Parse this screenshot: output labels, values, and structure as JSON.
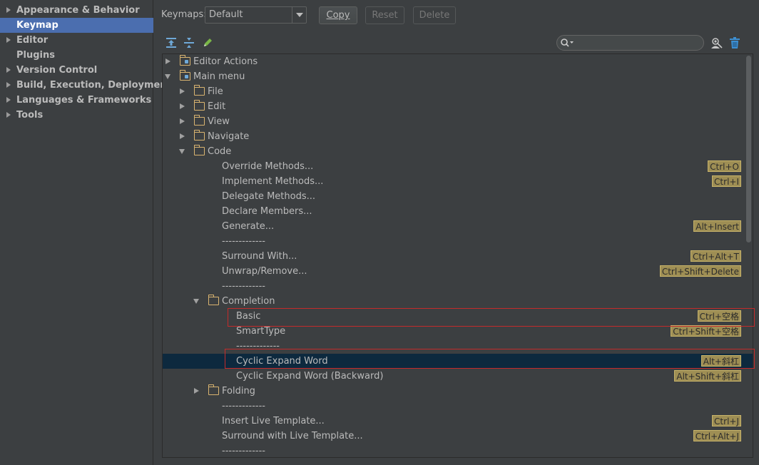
{
  "sidebar": {
    "items": [
      {
        "label": "Appearance & Behavior",
        "expandable": true,
        "selected": false
      },
      {
        "label": "Keymap",
        "expandable": false,
        "selected": true
      },
      {
        "label": "Editor",
        "expandable": true,
        "selected": false
      },
      {
        "label": "Plugins",
        "expandable": false,
        "selected": false
      },
      {
        "label": "Version Control",
        "expandable": true,
        "selected": false
      },
      {
        "label": "Build, Execution, Deployment",
        "expandable": true,
        "selected": false
      },
      {
        "label": "Languages & Frameworks",
        "expandable": true,
        "selected": false
      },
      {
        "label": "Tools",
        "expandable": true,
        "selected": false
      }
    ]
  },
  "header": {
    "keymaps_label": "Keymaps:",
    "keymap_value": "Default",
    "copy_label": "Copy",
    "reset_label": "Reset",
    "delete_label": "Delete"
  },
  "toolbar": {
    "icons": [
      "expand-all-icon",
      "collapse-all-icon",
      "edit-icon"
    ],
    "search_placeholder": "",
    "right_icons": [
      "find-shortcut-icon",
      "clear-icon"
    ]
  },
  "tree": {
    "rows": [
      {
        "label": "Editor Actions",
        "shortcut": ""
      },
      {
        "label": "Main menu",
        "shortcut": ""
      },
      {
        "label": "File",
        "shortcut": ""
      },
      {
        "label": "Edit",
        "shortcut": ""
      },
      {
        "label": "View",
        "shortcut": ""
      },
      {
        "label": "Navigate",
        "shortcut": ""
      },
      {
        "label": "Code",
        "shortcut": ""
      },
      {
        "label": "Override Methods...",
        "shortcut": "Ctrl+O"
      },
      {
        "label": "Implement Methods...",
        "shortcut": "Ctrl+I"
      },
      {
        "label": "Delegate Methods...",
        "shortcut": ""
      },
      {
        "label": "Declare Members...",
        "shortcut": ""
      },
      {
        "label": "Generate...",
        "shortcut": "Alt+Insert"
      },
      {
        "label": "-------------",
        "shortcut": ""
      },
      {
        "label": "Surround With...",
        "shortcut": "Ctrl+Alt+T"
      },
      {
        "label": "Unwrap/Remove...",
        "shortcut": "Ctrl+Shift+Delete"
      },
      {
        "label": "-------------",
        "shortcut": ""
      },
      {
        "label": "Completion",
        "shortcut": ""
      },
      {
        "label": "Basic",
        "shortcut": "Ctrl+空格"
      },
      {
        "label": "SmartType",
        "shortcut": "Ctrl+Shift+空格"
      },
      {
        "label": "-------------",
        "shortcut": ""
      },
      {
        "label": "Cyclic Expand Word",
        "shortcut": "Alt+斜杠"
      },
      {
        "label": "Cyclic Expand Word (Backward)",
        "shortcut": "Alt+Shift+斜杠"
      },
      {
        "label": "Folding",
        "shortcut": ""
      },
      {
        "label": "-------------",
        "shortcut": ""
      },
      {
        "label": "Insert Live Template...",
        "shortcut": "Ctrl+J"
      },
      {
        "label": "Surround with Live Template...",
        "shortcut": "Ctrl+Alt+J"
      },
      {
        "label": "-------------",
        "shortcut": ""
      }
    ]
  },
  "colors": {
    "background": "#3c3f41",
    "selection_sidebar": "#4b6eaf",
    "selection_tree": "#0d293e",
    "shortcut_badge": "#9e8e54",
    "highlight_box": "#c42b2b",
    "folder": "#d9b470"
  }
}
